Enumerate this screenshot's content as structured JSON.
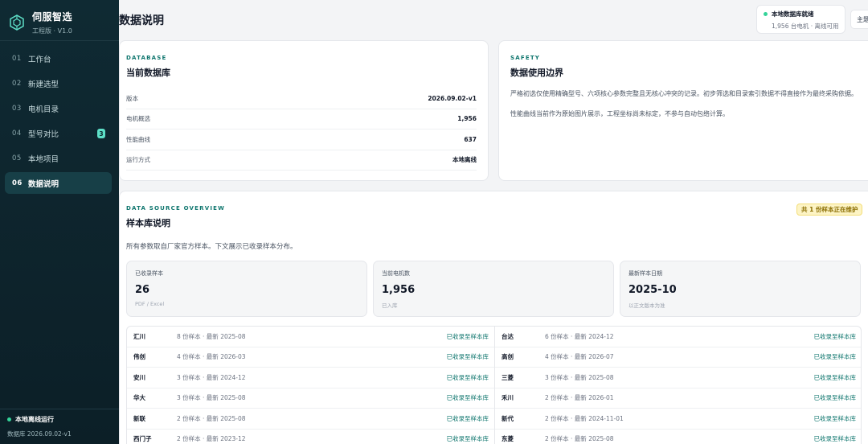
{
  "brand": {
    "name": "伺服智选",
    "version": "工程版 · V1.0"
  },
  "nav": [
    {
      "num": "01",
      "label": "工作台"
    },
    {
      "num": "02",
      "label": "新建选型"
    },
    {
      "num": "03",
      "label": "电机目录"
    },
    {
      "num": "04",
      "label": "型号对比",
      "badge": "3"
    },
    {
      "num": "05",
      "label": "本地项目"
    },
    {
      "num": "06",
      "label": "数据说明",
      "active": true
    }
  ],
  "sidebar_footer": {
    "status": "本地离线运行",
    "db": "数据库 2026.09.02-v1"
  },
  "header": {
    "title": "数据说明",
    "db_status_title": "本地数据库就绪",
    "db_status_detail": "1,956 台电机 · 离线可用",
    "theme_label": "主题"
  },
  "database": {
    "kicker": "DATABASE",
    "title": "当前数据库",
    "rows": [
      {
        "k": "版本",
        "v": "2026.09.02-v1"
      },
      {
        "k": "电机概选",
        "v": "1,956"
      },
      {
        "k": "性能曲线",
        "v": "637"
      },
      {
        "k": "运行方式",
        "v": "本地离线"
      }
    ]
  },
  "safety": {
    "kicker": "SAFETY",
    "title": "数据使用边界",
    "p1": "严格初选仅使用精确型号、六项核心参数完整且无核心冲突的记录。初步筛选和目录索引数据不得直接作为最终采购依据。",
    "p2": "性能曲线当前作为原始图片展示，工程坐标尚未标定，不参与自动包络计算。"
  },
  "source": {
    "kicker": "DATA SOURCE OVERVIEW",
    "title": "样本库说明",
    "maintenance": "共 1 份样本正在维护",
    "desc": "所有参数取自厂家官方样本。下文展示已收录样本分布。",
    "stats": [
      {
        "label": "已收录样本",
        "value": "26",
        "note": "PDF / Excel"
      },
      {
        "label": "当前电机数",
        "value": "1,956",
        "note": "已入库"
      },
      {
        "label": "最新样本日期",
        "value": "2025-10",
        "note": "以正文版本为准"
      }
    ],
    "vendors_left": [
      {
        "name": "汇川",
        "meta": "8 份样本 · 最新 2025-08",
        "status": "已收录至样本库"
      },
      {
        "name": "伟创",
        "meta": "4 份样本 · 最新 2026-03",
        "status": "已收录至样本库"
      },
      {
        "name": "安川",
        "meta": "3 份样本 · 最新 2024-12",
        "status": "已收录至样本库"
      },
      {
        "name": "华大",
        "meta": "3 份样本 · 最新 2025-08",
        "status": "已收录至样本库"
      },
      {
        "name": "新联",
        "meta": "2 份样本 · 最新 2025-08",
        "status": "已收录至样本库"
      },
      {
        "name": "西门子",
        "meta": "2 份样本 · 最新 2023-12",
        "status": "已收录至样本库"
      }
    ],
    "vendors_right": [
      {
        "name": "台达",
        "meta": "6 份样本 · 最新 2024-12",
        "status": "已收录至样本库"
      },
      {
        "name": "高创",
        "meta": "4 份样本 · 最新 2026-07",
        "status": "已收录至样本库"
      },
      {
        "name": "三菱",
        "meta": "3 份样本 · 最新 2025-08",
        "status": "已收录至样本库"
      },
      {
        "name": "禾川",
        "meta": "2 份样本 · 最新 2026-01",
        "status": "已收录至样本库"
      },
      {
        "name": "新代",
        "meta": "2 份样本 · 最新 2024-11-01",
        "status": "已收录至样本库"
      },
      {
        "name": "东菱",
        "meta": "2 份样本 · 最新 2025-08",
        "status": "已收录至样本库"
      }
    ]
  }
}
